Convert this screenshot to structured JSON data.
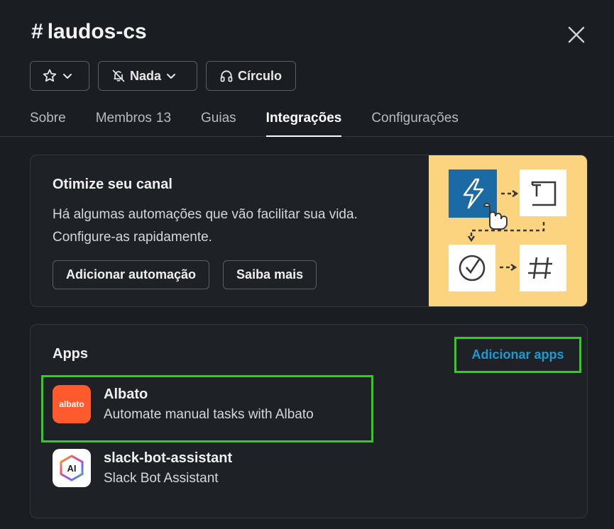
{
  "channel": {
    "hash": "#",
    "name": "laudos-cs"
  },
  "chips": {
    "star_icon": "star-icon",
    "notifications_label": "Nada",
    "huddle_label": "Círculo"
  },
  "tabs": [
    {
      "label": "Sobre"
    },
    {
      "label": "Membros",
      "count": "13"
    },
    {
      "label": "Guias"
    },
    {
      "label": "Integrações"
    },
    {
      "label": "Configurações"
    }
  ],
  "promo": {
    "title": "Otimize seu canal",
    "line1": "Há algumas automações que vão facilitar sua vida.",
    "line2": "Configure-as rapidamente.",
    "add_automation_label": "Adicionar automação",
    "learn_more_label": "Saiba mais"
  },
  "apps_section": {
    "title": "Apps",
    "add_apps_label": "Adicionar apps",
    "items": [
      {
        "name": "Albato",
        "description": "Automate manual tasks with Albato",
        "icon_text": "albato",
        "icon_color": "#ff5a2d"
      },
      {
        "name": "slack-bot-assistant",
        "description": "Slack Bot Assistant",
        "icon_text": "AI",
        "icon_color": "#ffffff"
      }
    ]
  },
  "colors": {
    "background": "#1a1d21",
    "link": "#1d9bd1",
    "highlight": "#2ed11a",
    "promo_art_bg": "#fcd47f"
  }
}
